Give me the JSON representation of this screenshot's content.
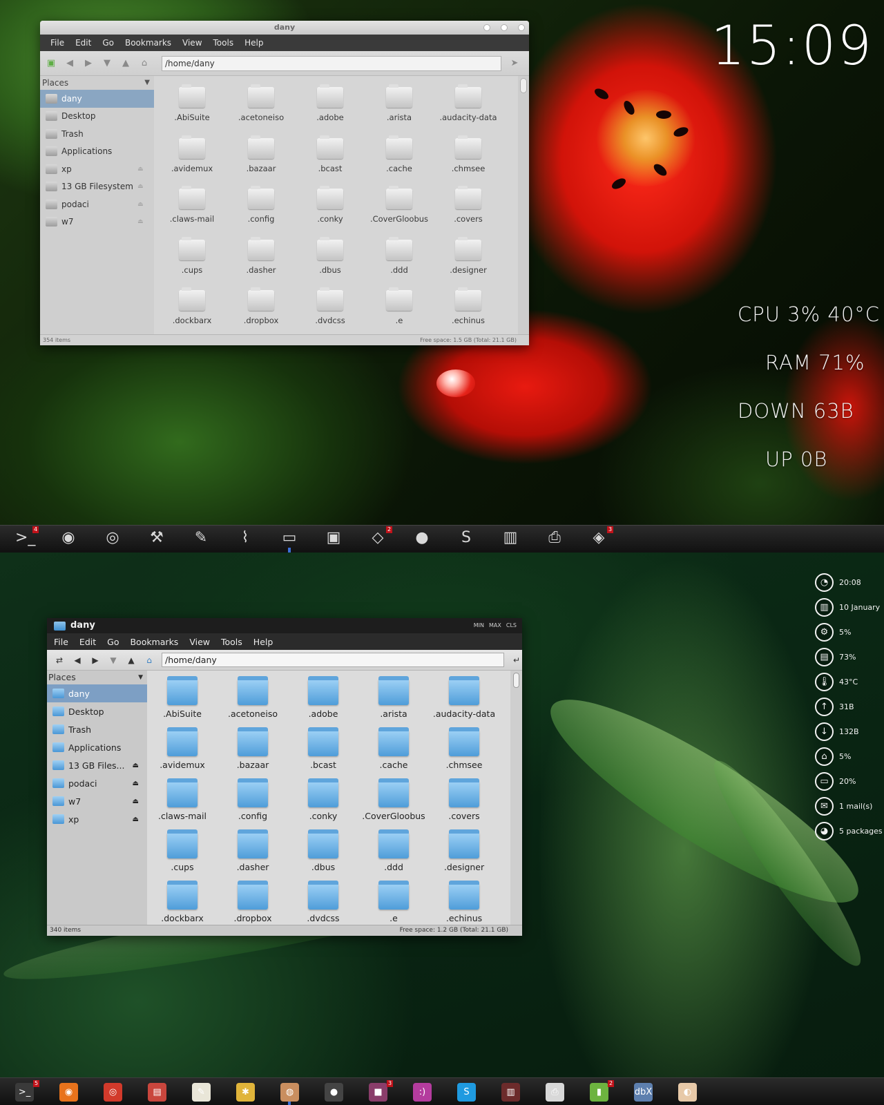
{
  "top": {
    "clock": "15:09",
    "stats": {
      "cpu": "CPU  3%  40°C",
      "ram": "RAM  71%",
      "down": "DOWN  63B",
      "up": "UP  0B"
    },
    "window": {
      "title": "dany",
      "menu": [
        "File",
        "Edit",
        "Go",
        "Bookmarks",
        "View",
        "Tools",
        "Help"
      ],
      "path": "/home/dany",
      "places_label": "Places",
      "places": [
        {
          "label": "dany",
          "selected": true,
          "eject": false
        },
        {
          "label": "Desktop",
          "selected": false,
          "eject": false
        },
        {
          "label": "Trash",
          "selected": false,
          "eject": false
        },
        {
          "label": "Applications",
          "selected": false,
          "eject": false
        },
        {
          "label": "xp",
          "selected": false,
          "eject": true
        },
        {
          "label": "13 GB Filesystem",
          "selected": false,
          "eject": true
        },
        {
          "label": "podaci",
          "selected": false,
          "eject": true
        },
        {
          "label": "w7",
          "selected": false,
          "eject": true
        }
      ],
      "files": [
        ".AbiSuite",
        ".acetoneiso",
        ".adobe",
        ".arista",
        ".audacity-data",
        ".avidemux",
        ".bazaar",
        ".bcast",
        ".cache",
        ".chmsee",
        ".claws-mail",
        ".config",
        ".conky",
        ".CoverGloobus",
        ".covers",
        ".cups",
        ".dasher",
        ".dbus",
        ".ddd",
        ".designer",
        ".dockbarx",
        ".dropbox",
        ".dvdcss",
        ".e",
        ".echinus"
      ],
      "status_items": "354 items",
      "status_free": "Free space: 1.5 GB (Total: 21.1 GB)"
    },
    "dock": [
      {
        "name": "terminal-icon",
        "glyph": ">_",
        "badge": "4"
      },
      {
        "name": "firefox-icon",
        "glyph": "◉",
        "badge": ""
      },
      {
        "name": "chrome-icon",
        "glyph": "◎",
        "badge": ""
      },
      {
        "name": "tools-icon",
        "glyph": "⚒",
        "badge": ""
      },
      {
        "name": "pencil-icon",
        "glyph": "✎",
        "badge": ""
      },
      {
        "name": "bird-icon",
        "glyph": "⌇",
        "badge": ""
      },
      {
        "name": "file-manager-icon",
        "glyph": "▭",
        "badge": "",
        "running": true
      },
      {
        "name": "monitor-icon",
        "glyph": "▣",
        "badge": ""
      },
      {
        "name": "box-icon",
        "glyph": "◇",
        "badge": "2"
      },
      {
        "name": "chat-icon",
        "glyph": "●",
        "badge": ""
      },
      {
        "name": "skype-icon",
        "glyph": "S",
        "badge": ""
      },
      {
        "name": "book-icon",
        "glyph": "▥",
        "badge": ""
      },
      {
        "name": "scanner-icon",
        "glyph": "⎙",
        "badge": ""
      },
      {
        "name": "package-icon",
        "glyph": "◈",
        "badge": "3"
      }
    ]
  },
  "bottom": {
    "side": [
      {
        "name": "clock-icon",
        "glyph": "◔",
        "text": "20:08"
      },
      {
        "name": "calendar-icon",
        "glyph": "▥",
        "text": "10 January"
      },
      {
        "name": "cpu-icon",
        "glyph": "⚙",
        "text": "5%"
      },
      {
        "name": "ram-icon",
        "glyph": "▤",
        "text": "73%"
      },
      {
        "name": "temperature-icon",
        "glyph": "🌡",
        "text": "43°C"
      },
      {
        "name": "upload-icon",
        "glyph": "↑",
        "text": "31B"
      },
      {
        "name": "download-icon",
        "glyph": "↓",
        "text": "132B"
      },
      {
        "name": "home-disk-icon",
        "glyph": "⌂",
        "text": "5%"
      },
      {
        "name": "root-disk-icon",
        "glyph": "▭",
        "text": "20%"
      },
      {
        "name": "mail-icon",
        "glyph": "✉",
        "text": "1 mail(s)"
      },
      {
        "name": "packages-icon",
        "glyph": "◕",
        "text": "5 packages"
      }
    ],
    "window": {
      "title": "dany",
      "controls": [
        "MIN",
        "MAX",
        "CLS"
      ],
      "menu": [
        "File",
        "Edit",
        "Go",
        "Bookmarks",
        "View",
        "Tools",
        "Help"
      ],
      "path": "/home/dany",
      "places_label": "Places",
      "places": [
        {
          "label": "dany",
          "selected": true,
          "eject": false
        },
        {
          "label": "Desktop",
          "selected": false,
          "eject": false
        },
        {
          "label": "Trash",
          "selected": false,
          "eject": false
        },
        {
          "label": "Applications",
          "selected": false,
          "eject": false
        },
        {
          "label": "13 GB Files...",
          "selected": false,
          "eject": true
        },
        {
          "label": "podaci",
          "selected": false,
          "eject": true
        },
        {
          "label": "w7",
          "selected": false,
          "eject": true
        },
        {
          "label": "xp",
          "selected": false,
          "eject": true
        }
      ],
      "files": [
        ".AbiSuite",
        ".acetoneiso",
        ".adobe",
        ".arista",
        ".audacity-data",
        ".avidemux",
        ".bazaar",
        ".bcast",
        ".cache",
        ".chmsee",
        ".claws-mail",
        ".config",
        ".conky",
        ".CoverGloobus",
        ".covers",
        ".cups",
        ".dasher",
        ".dbus",
        ".ddd",
        ".designer",
        ".dockbarx",
        ".dropbox",
        ".dvdcss",
        ".e",
        ".echinus"
      ],
      "status_items": "340 items",
      "status_free": "Free space: 1.2 GB (Total: 21.1 GB)"
    },
    "dock": [
      {
        "name": "terminal-icon",
        "glyph": ">_",
        "badge": "5",
        "color": "#3a3a3a"
      },
      {
        "name": "firefox-icon",
        "glyph": "◉",
        "badge": "",
        "color": "#e8731c"
      },
      {
        "name": "chrome-icon",
        "glyph": "◎",
        "badge": "",
        "color": "#d23a2b"
      },
      {
        "name": "archive-icon",
        "glyph": "▤",
        "badge": "",
        "color": "#c9463d"
      },
      {
        "name": "text-editor-icon",
        "glyph": "✎",
        "badge": "",
        "color": "#e9e6d8"
      },
      {
        "name": "paint-icon",
        "glyph": "✱",
        "badge": "",
        "color": "#e0b43a"
      },
      {
        "name": "file-manager-icon",
        "glyph": "◍",
        "badge": "",
        "color": "#c98e5f",
        "running": true
      },
      {
        "name": "camera-icon",
        "glyph": "●",
        "badge": "",
        "color": "#444"
      },
      {
        "name": "box-icon",
        "glyph": "■",
        "badge": "3",
        "color": "#8a3d6a"
      },
      {
        "name": "chat-icon",
        "glyph": ":)",
        "badge": "",
        "color": "#b43c9e"
      },
      {
        "name": "skype-icon",
        "glyph": "S",
        "badge": "",
        "color": "#1f9ae0"
      },
      {
        "name": "book-icon",
        "glyph": "▥",
        "badge": "",
        "color": "#6c2b2b"
      },
      {
        "name": "scanner-icon",
        "glyph": "⎙",
        "badge": "",
        "color": "#d8d8d8"
      },
      {
        "name": "package-icon",
        "glyph": "▮",
        "badge": "2",
        "color": "#6db33f"
      },
      {
        "name": "dbx-icon",
        "glyph": "dbX",
        "badge": "",
        "color": "#5d7fae"
      },
      {
        "name": "eye-icon",
        "glyph": "◐",
        "badge": "",
        "color": "#e7c9a8"
      }
    ]
  }
}
